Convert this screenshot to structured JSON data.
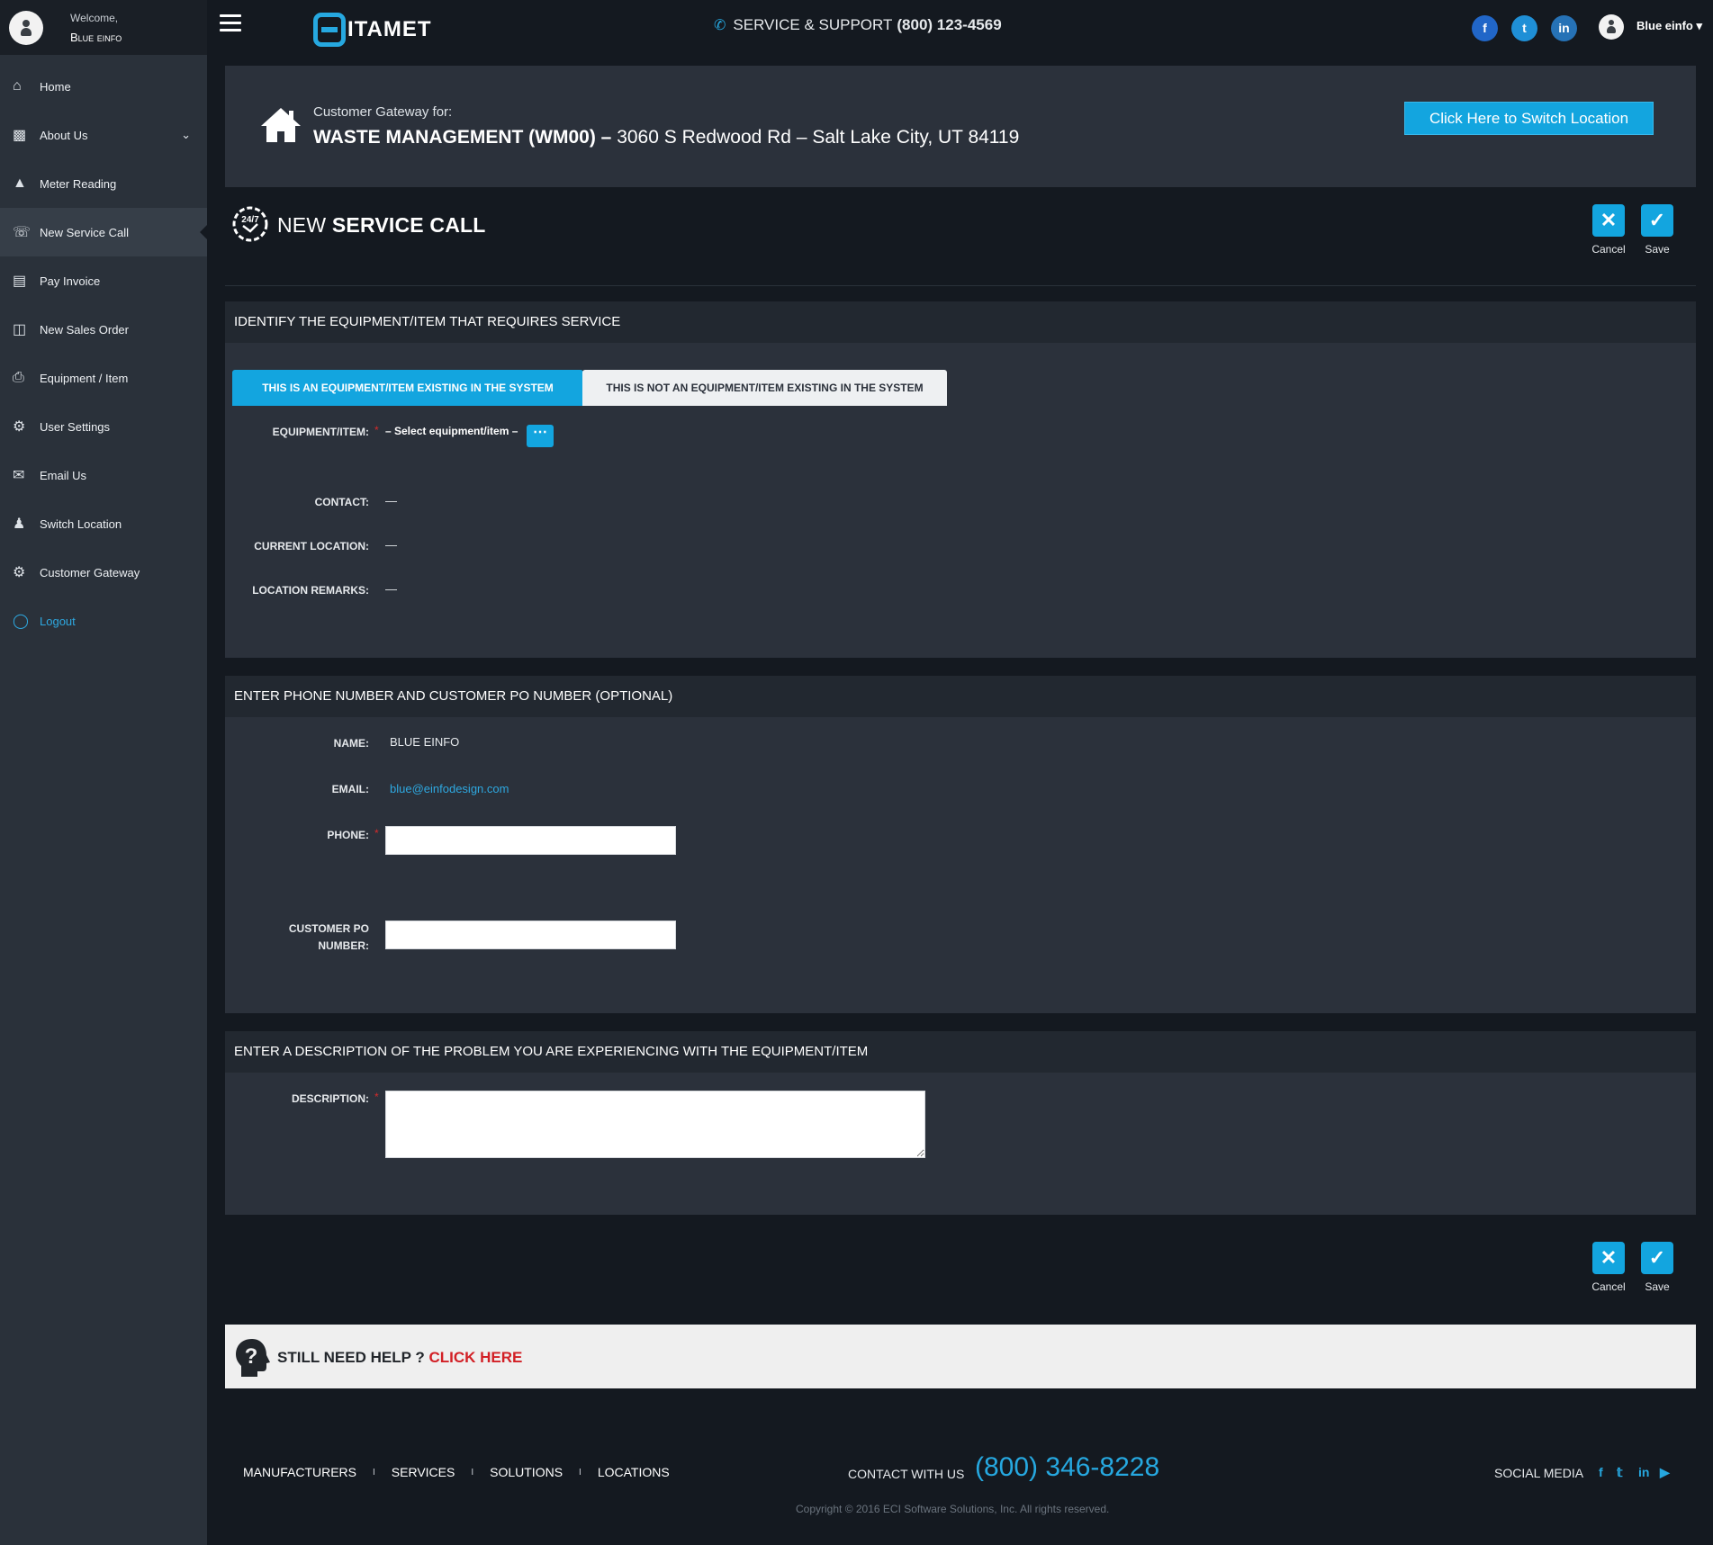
{
  "sidebar": {
    "welcome": "Welcome,",
    "user_name": "Blue einfo",
    "items": [
      {
        "label": "Home",
        "icon": "home-icon"
      },
      {
        "label": "About Us",
        "icon": "briefcase-icon"
      },
      {
        "label": "Meter Reading",
        "icon": "chart-icon"
      },
      {
        "label": "New Service Call",
        "icon": "service-call-icon"
      },
      {
        "label": "Pay Invoice",
        "icon": "invoice-icon"
      },
      {
        "label": "New Sales Order",
        "icon": "sales-order-icon"
      },
      {
        "label": "Equipment / Item",
        "icon": "printer-icon"
      },
      {
        "label": "User Settings",
        "icon": "gear-icon"
      },
      {
        "label": "Email Us",
        "icon": "envelope-icon"
      },
      {
        "label": "Switch Location",
        "icon": "users-icon"
      },
      {
        "label": "Customer Gateway",
        "icon": "gears-icon"
      },
      {
        "label": "Logout",
        "icon": "unlock-icon"
      }
    ]
  },
  "header": {
    "logo": "ITAMET",
    "support_label": "SERVICE & SUPPORT",
    "support_phone": "(800) 123-4569",
    "user_name": "Blue einfo"
  },
  "gateway": {
    "label": "Customer Gateway for:",
    "company": "WASTE MANAGEMENT (WM00) –",
    "address": "3060 S Redwood Rd – Salt Lake City, UT 84119",
    "switch_button": "Click Here to Switch Location"
  },
  "page": {
    "title_light": "NEW",
    "title_bold": "SERVICE CALL",
    "cancel": "Cancel",
    "save": "Save"
  },
  "section1": {
    "heading": "IDENTIFY THE EQUIPMENT/ITEM THAT REQUIRES SERVICE",
    "tab_existing": "THIS IS AN EQUIPMENT/ITEM EXISTING IN THE SYSTEM",
    "tab_not_existing": "THIS IS NOT AN EQUIPMENT/ITEM EXISTING IN THE SYSTEM",
    "equipment_label": "EQUIPMENT/ITEM:",
    "equipment_value": "– Select equipment/item –",
    "contact_label": "CONTACT:",
    "contact_value": "—",
    "location_label": "CURRENT LOCATION:",
    "location_value": "—",
    "remarks_label": "LOCATION REMARKS:",
    "remarks_value": "—"
  },
  "section2": {
    "heading": "ENTER PHONE NUMBER AND CUSTOMER PO NUMBER (OPTIONAL)",
    "name_label": "NAME:",
    "name_value": "BLUE EINFO",
    "email_label": "EMAIL:",
    "email_value": "blue@einfodesign.com",
    "phone_label": "PHONE:",
    "phone_value": "",
    "po_label_1": "CUSTOMER PO",
    "po_label_2": "NUMBER:",
    "po_value": ""
  },
  "section3": {
    "heading": "ENTER A DESCRIPTION OF THE PROBLEM YOU ARE EXPERIENCING WITH THE EQUIPMENT/ITEM",
    "description_label": "DESCRIPTION:",
    "description_value": ""
  },
  "help": {
    "text": "STILL NEED HELP ?",
    "link": "CLICK HERE"
  },
  "footer": {
    "links": [
      "MANUFACTURERS",
      "SERVICES",
      "SOLUTIONS",
      "LOCATIONS"
    ],
    "separator": "I",
    "contact_label": "CONTACT WITH US",
    "contact_phone": "(800) 346-8228",
    "social_label": "SOCIAL MEDIA",
    "copyright": "Copyright © 2016 ECI Software Solutions, Inc. All rights reserved."
  },
  "colors": {
    "accent": "#13a5df",
    "sidebar_bg": "#2a313a",
    "page_bg": "#141920",
    "panel_bg": "#2b313b",
    "required": "#d62b2b",
    "help_link": "#d21f25"
  }
}
